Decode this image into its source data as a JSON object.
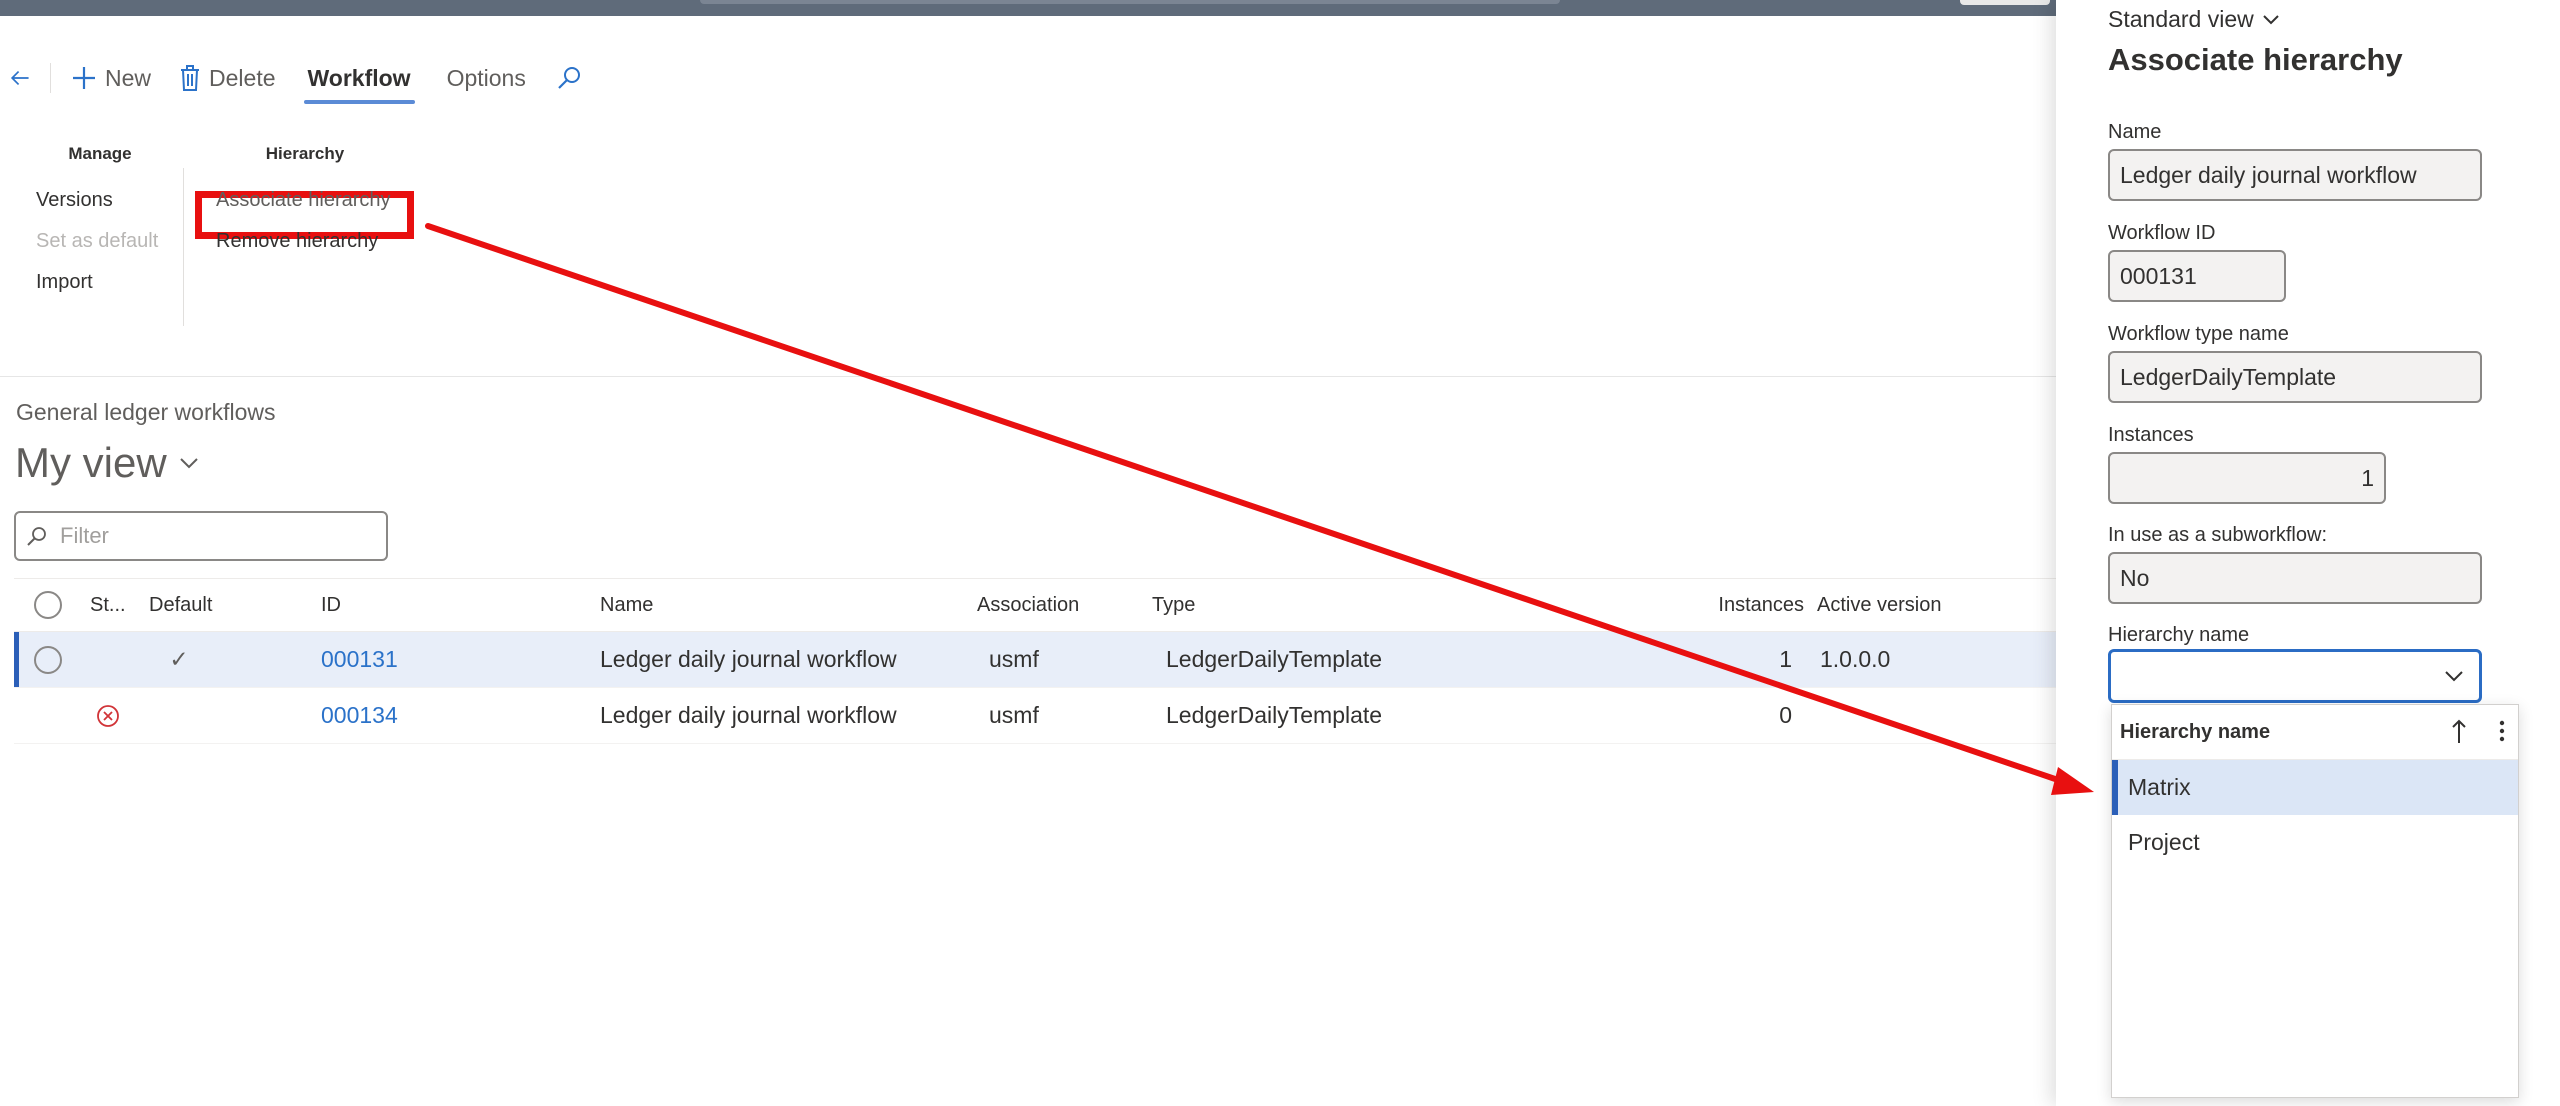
{
  "actionpane": {
    "new_label": "New",
    "delete_label": "Delete",
    "tabs": [
      {
        "label": "Workflow"
      },
      {
        "label": "Options"
      }
    ],
    "groups": {
      "manage": {
        "title": "Manage",
        "items": [
          {
            "label": "Versions"
          },
          {
            "label": "Set as default"
          },
          {
            "label": "Import"
          }
        ]
      },
      "hierarchy": {
        "title": "Hierarchy",
        "items": [
          {
            "label": "Associate hierarchy"
          },
          {
            "label": "Remove hierarchy"
          }
        ]
      }
    }
  },
  "list": {
    "caption": "General ledger workflows",
    "view_name": "My view",
    "filter_placeholder": "Filter",
    "columns": {
      "status": "St...",
      "default": "Default",
      "id": "ID",
      "name": "Name",
      "association": "Association",
      "type": "Type",
      "instances": "Instances",
      "active_version": "Active version"
    },
    "rows": [
      {
        "default_mark": "✓",
        "id": "000131",
        "name": "Ledger daily journal workflow",
        "association": "usmf",
        "type": "LedgerDailyTemplate",
        "instances": "1",
        "active_version": "1.0.0.0",
        "status": "",
        "selected": true
      },
      {
        "default_mark": "",
        "id": "000134",
        "name": "Ledger daily journal workflow",
        "association": "usmf",
        "type": "LedgerDailyTemplate",
        "instances": "0",
        "active_version": "",
        "status": "error",
        "selected": false
      }
    ]
  },
  "panel": {
    "standard_view": "Standard view",
    "title": "Associate hierarchy",
    "fields": {
      "name_label": "Name",
      "name_value": "Ledger daily journal workflow",
      "workflow_id_label": "Workflow ID",
      "workflow_id_value": "000131",
      "workflow_type_label": "Workflow type name",
      "workflow_type_value": "LedgerDailyTemplate",
      "instances_label": "Instances",
      "instances_value": "1",
      "subworkflow_label": "In use as a subworkflow:",
      "subworkflow_value": "No",
      "hierarchy_label": "Hierarchy name",
      "hierarchy_value": ""
    },
    "dropdown": {
      "header": "Hierarchy name",
      "options": [
        {
          "label": "Matrix",
          "selected": true
        },
        {
          "label": "Project",
          "selected": false
        }
      ]
    }
  },
  "colors": {
    "accent": "#2b5fb8",
    "link": "#2b72c9",
    "annotation": "#e81010"
  }
}
